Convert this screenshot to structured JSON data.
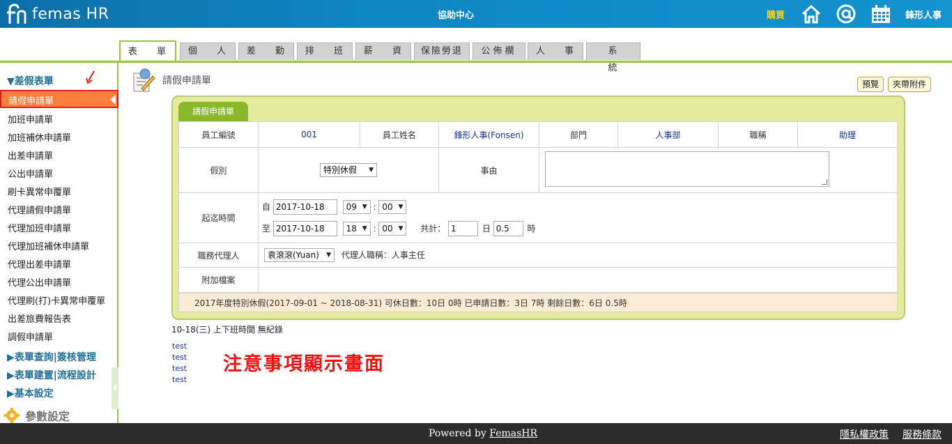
{
  "header": {
    "logo_text": "femas HR",
    "center_title": "協助中心",
    "buy_label": "購買",
    "company_name": "鋒形人事",
    "icons": [
      "home-icon",
      "at-icon",
      "calendar-icon"
    ]
  },
  "tabs": [
    {
      "label": "表 單",
      "active": true
    },
    {
      "label": "個 人",
      "active": false
    },
    {
      "label": "差 勤",
      "active": false
    },
    {
      "label": "排 班",
      "active": false
    },
    {
      "label": "薪 資",
      "active": false
    },
    {
      "label": "保險勞退",
      "active": false
    },
    {
      "label": "公佈欄",
      "active": false
    },
    {
      "label": "人 事",
      "active": false
    },
    {
      "label": "系 統",
      "active": false
    }
  ],
  "sidebar": {
    "section_main": "▼差假表單",
    "items": [
      "請假申請單",
      "加班申請單",
      "加班補休申請單",
      "出差申請單",
      "公出申請單",
      "刷卡異常申覆單",
      "代理請假申請單",
      "代理加班申請單",
      "代理加班補休申請單",
      "代理出差申請單",
      "代理公出申請單",
      "代理刷(打)卡異常申覆單",
      "出差旅費報告表",
      "調假申請單"
    ],
    "sections": [
      "▶表單查詢|簽核管理",
      "▶表單建置|流程設計",
      "▶基本設定"
    ],
    "param_label": "參數設定"
  },
  "main": {
    "page_title": "請假申請單",
    "preview_button": "預覽",
    "attach_button": "夾帶附件",
    "form_tab": "請假申請單",
    "row1": {
      "emp_no_label": "員工編號",
      "emp_no": "001",
      "emp_name_label": "員工姓名",
      "emp_name": "鋒形人事(Fonsen)",
      "dept_label": "部門",
      "dept": "人事部",
      "title_label": "職稱",
      "title": "助理"
    },
    "leave_type_label": "假別",
    "leave_type": "特別休假",
    "reason_label": "事由",
    "reason": "",
    "period_label": "起迄時間",
    "from_prefix": "自",
    "from_date": "2017-10-18",
    "from_hour": "09",
    "from_min": "00",
    "to_prefix": "至",
    "to_date": "2017-10-18",
    "to_hour": "18",
    "to_min": "00",
    "colon": ":",
    "total_label": "共計：",
    "total_days": "1",
    "day_unit": "日",
    "total_hours": "0.5",
    "hour_unit": "時",
    "agent_label": "職務代理人",
    "agent": "袁滾滾(Yuan)",
    "agent_title": "代理人職稱：人事主任",
    "attachment_label": "附加檔案",
    "summary": "2017年度特別休假(2017-09-01 ~ 2018-08-31)  可休日數：10日 0時  已申請日數：3日 7時  剩餘日數：6日 0.5時",
    "schedule_line": "10-18(三)   上下班時間 無紀錄",
    "tests": [
      "test",
      "test",
      "test",
      "test"
    ],
    "notice": "注意事項顯示畫面"
  },
  "footer": {
    "powered_prefix": "Powered by ",
    "powered_link": "FemasHR",
    "privacy": "隱私權政策",
    "terms": "服務條款"
  },
  "colors": {
    "header_blue": "#0f86c4",
    "accent_green": "#9bc43a",
    "active_item": "#ff7f3f",
    "notice_red": "#ee1111"
  }
}
